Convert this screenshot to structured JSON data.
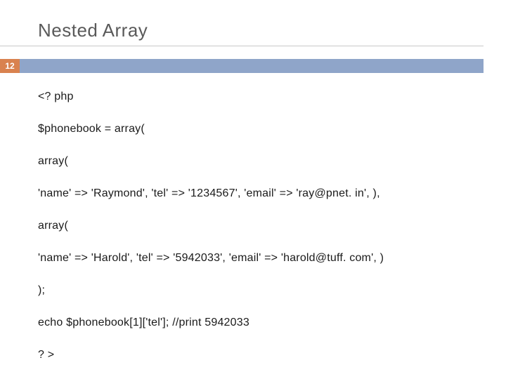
{
  "title": "Nested Array",
  "page_number": "12",
  "code_lines": [
    "<? php",
    "$phonebook = array(",
    "array(",
    "'name' => 'Raymond', 'tel' => '1234567', 'email' => 'ray@pnet. in', ),",
    "array(",
    "'name' => 'Harold', 'tel' => '5942033', 'email' => 'harold@tuff. com', )",
    ");",
    "echo $phonebook[1]['tel']; //print 5942033",
    "? >"
  ]
}
